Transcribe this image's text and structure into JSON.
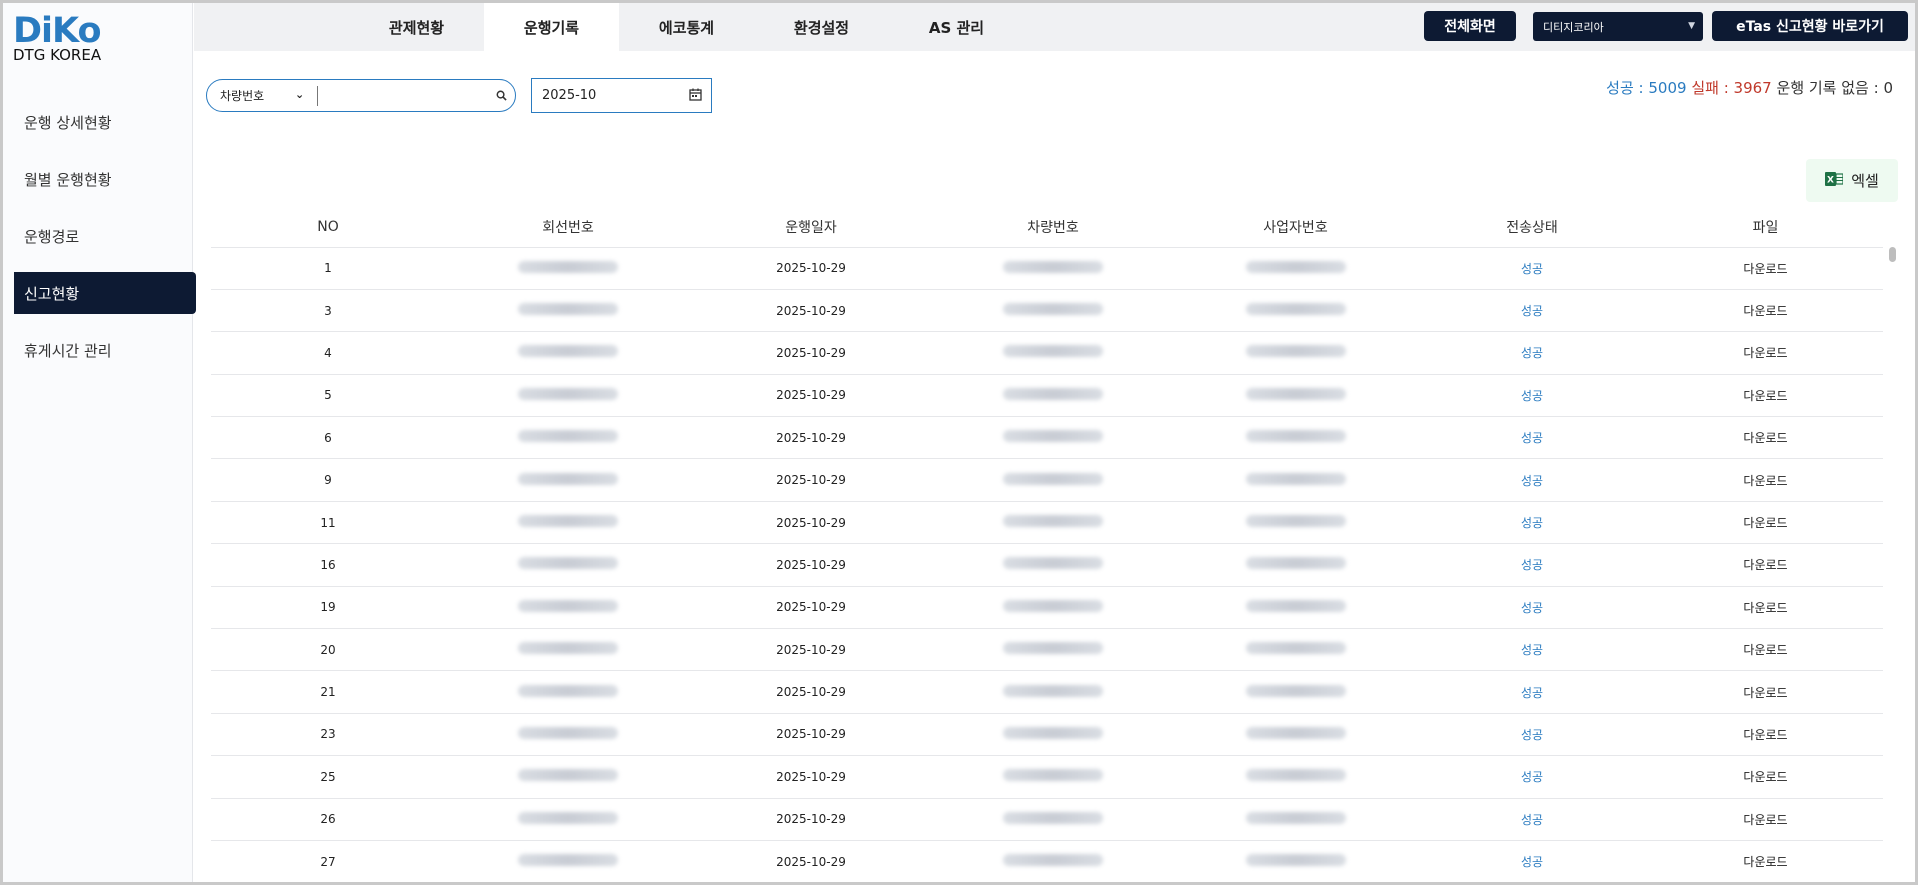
{
  "logo": {
    "main": "DiKo",
    "sub": "DTG KOREA"
  },
  "sidebar": {
    "items": [
      {
        "label": "운행 상세현황",
        "active": false
      },
      {
        "label": "월별 운행현황",
        "active": false
      },
      {
        "label": "운행경로",
        "active": false
      },
      {
        "label": "신고현황",
        "active": true
      },
      {
        "label": "휴게시간 관리",
        "active": false
      }
    ]
  },
  "topbar": {
    "tabs": [
      {
        "label": "관제현황",
        "active": false
      },
      {
        "label": "운행기록",
        "active": true
      },
      {
        "label": "에코통계",
        "active": false
      },
      {
        "label": "환경설정",
        "active": false
      },
      {
        "label": "AS 관리",
        "active": false
      }
    ],
    "fullscreen_label": "전체화면",
    "company_select": "디티지코리아",
    "etas_label": "eTas 신고현황 바로가기"
  },
  "filters": {
    "search_field": "차량번호",
    "search_value": "",
    "month": "2025-10"
  },
  "stats": {
    "success_label": "성공 : ",
    "success_value": "5009",
    "fail_label": "실패 : ",
    "fail_value": "3967",
    "none_label": "운행 기록 없음 : ",
    "none_value": "0"
  },
  "excel_label": "엑셀",
  "colors": {
    "brand": "#2a7bc0",
    "dark_navy": "#0d1a33",
    "fail": "#c0392b",
    "excel_green": "#1e7145"
  },
  "table": {
    "headers": [
      "NO",
      "회선번호",
      "운행일자",
      "차량번호",
      "사업자번호",
      "전송상태",
      "파일"
    ],
    "rows": [
      {
        "no": "1",
        "date": "2025-10-29",
        "status": "성공",
        "file": "다운로드"
      },
      {
        "no": "3",
        "date": "2025-10-29",
        "status": "성공",
        "file": "다운로드"
      },
      {
        "no": "4",
        "date": "2025-10-29",
        "status": "성공",
        "file": "다운로드"
      },
      {
        "no": "5",
        "date": "2025-10-29",
        "status": "성공",
        "file": "다운로드"
      },
      {
        "no": "6",
        "date": "2025-10-29",
        "status": "성공",
        "file": "다운로드"
      },
      {
        "no": "9",
        "date": "2025-10-29",
        "status": "성공",
        "file": "다운로드"
      },
      {
        "no": "11",
        "date": "2025-10-29",
        "status": "성공",
        "file": "다운로드"
      },
      {
        "no": "16",
        "date": "2025-10-29",
        "status": "성공",
        "file": "다운로드"
      },
      {
        "no": "19",
        "date": "2025-10-29",
        "status": "성공",
        "file": "다운로드"
      },
      {
        "no": "20",
        "date": "2025-10-29",
        "status": "성공",
        "file": "다운로드"
      },
      {
        "no": "21",
        "date": "2025-10-29",
        "status": "성공",
        "file": "다운로드"
      },
      {
        "no": "23",
        "date": "2025-10-29",
        "status": "성공",
        "file": "다운로드"
      },
      {
        "no": "25",
        "date": "2025-10-29",
        "status": "성공",
        "file": "다운로드"
      },
      {
        "no": "26",
        "date": "2025-10-29",
        "status": "성공",
        "file": "다운로드"
      },
      {
        "no": "27",
        "date": "2025-10-29",
        "status": "성공",
        "file": "다운로드"
      }
    ]
  }
}
